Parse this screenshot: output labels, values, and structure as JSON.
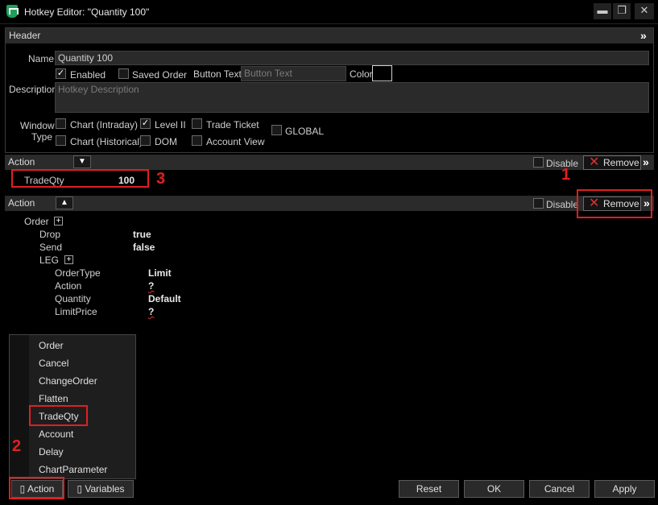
{
  "window": {
    "title": "Hotkey Editor: \"Quantity 100\"",
    "min": "▬",
    "max": "❐",
    "close": "✕"
  },
  "header": {
    "label": "Header",
    "name_label": "Name",
    "name_value": "Quantity 100",
    "enabled_label": "Enabled",
    "saved_order_label": "Saved Order",
    "button_text_label": "Button Text",
    "button_text_placeholder": "Button Text",
    "color_label": "Color",
    "description_label": "Description",
    "description_placeholder": "Hotkey Description",
    "window_type_label_1": "Window",
    "window_type_label_2": "Type",
    "window_types": {
      "chart_intraday": "Chart (Intraday)",
      "level2": "Level II",
      "trade_ticket": "Trade Ticket",
      "chart_historical": "Chart (Historical)",
      "dom": "DOM",
      "account_view": "Account View",
      "global": "GLOBAL"
    }
  },
  "action1": {
    "label": "Action",
    "toggle": "▼",
    "disable": "Disable",
    "remove": "Remove",
    "param_name": "TradeQty",
    "param_value": "100"
  },
  "action2": {
    "label": "Action",
    "toggle": "▲",
    "disable": "Disable",
    "remove": "Remove",
    "tree": {
      "order": "Order",
      "drop": "Drop",
      "drop_val": "true",
      "send": "Send",
      "send_val": "false",
      "leg": "LEG",
      "ordertype": "OrderType",
      "ordertype_val": "Limit",
      "action": "Action",
      "action_val": "?",
      "quantity": "Quantity",
      "quantity_val": "Default",
      "limitprice": "LimitPrice",
      "limitprice_val": "?"
    }
  },
  "menu": {
    "items": [
      "Order",
      "Cancel",
      "ChangeOrder",
      "Flatten",
      "TradeQty",
      "Account",
      "Delay",
      "ChartParameter"
    ]
  },
  "footer": {
    "action": "▯ Action",
    "variables": "▯ Variables",
    "reset": "Reset",
    "ok": "OK",
    "cancel": "Cancel",
    "apply": "Apply"
  },
  "annotations": {
    "one": "1",
    "two": "2",
    "three": "3"
  },
  "colors": {
    "annotation": "#e02020",
    "remove_x": "#e0302e",
    "accent_icon": "#1ea05a"
  }
}
